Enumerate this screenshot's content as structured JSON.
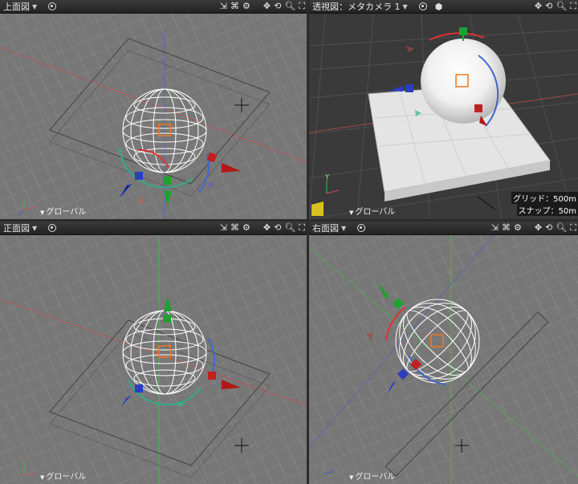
{
  "viewports": {
    "top": {
      "title": "上面図",
      "coord_mode": "グローバル"
    },
    "perspective": {
      "title": "透視図：メタカメラ 1",
      "coord_mode": "グローバル",
      "grid_info": "グリッド：500m",
      "snap_info": "スナップ：50m"
    },
    "front": {
      "title": "正面図",
      "coord_mode": "グローバル"
    },
    "right": {
      "title": "右面図",
      "coord_mode": "グローバル"
    }
  },
  "toolbar_icons": [
    "zoom-fit-icon",
    "layout-icon",
    "settings-icon",
    "pan-icon",
    "rotate-icon",
    "zoom-icon",
    "expand-icon"
  ],
  "colors": {
    "viewport_bg": "#787878",
    "grid_line": "#8e8e8e",
    "axis_x": "#c85050",
    "axis_y": "#4fb04f",
    "axis_z": "#4a5cc8",
    "selection_orange": "#f07820"
  }
}
